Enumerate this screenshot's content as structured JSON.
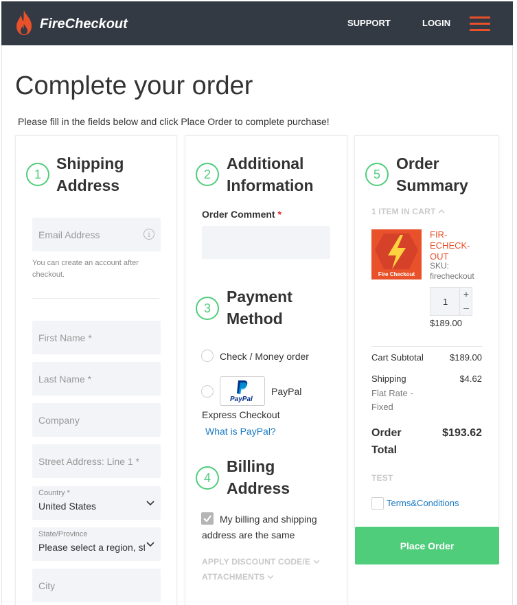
{
  "header": {
    "logo_text": "FireCheckout",
    "nav": {
      "support": "SUPPORT",
      "login": "LOGIN"
    }
  },
  "page": {
    "title": "Complete your order",
    "subtitle": "Please fill in the fields below and click Place Order to complete purchase!"
  },
  "shipping": {
    "step": "1",
    "title_line1": "Shipping",
    "title_line2": "Address",
    "email_placeholder": "Email Address",
    "email_hint": "You can create an account after checkout.",
    "first_name": "First Name *",
    "last_name": "Last Name *",
    "company": "Company",
    "street": "Street Address: Line 1 *",
    "country_label": "Country *",
    "country_value": "United States",
    "state_label": "State/Province",
    "state_value": "Please select a region, st",
    "city": "City"
  },
  "additional": {
    "step": "2",
    "title_line1": "Additional",
    "title_line2": "Information",
    "comment_label": "Order Comment",
    "required_mark": "*"
  },
  "payment": {
    "step": "3",
    "title_line1": "Payment",
    "title_line2": "Method",
    "option_check": "Check / Money order",
    "option_paypal_line1": "PayPal",
    "option_paypal_line2": "Express Checkout",
    "paypal_logo_text": "PayPal",
    "paypal_link": "What is PayPal?"
  },
  "billing": {
    "step": "4",
    "title_line1": "Billing",
    "title_line2": "Address",
    "same_line1": "My billing and shipping",
    "same_line2": "address are the same",
    "discount": "APPLY DISCOUNT CODE/E",
    "attachments": "ATTACHMENTS"
  },
  "summary": {
    "step": "5",
    "title_line1": "Order",
    "title_line2": "Summary",
    "items_in_cart": "1 ITEM IN CART",
    "product": {
      "name": "FIR-ECHECK-OUT",
      "thumb_label": "Fire Checkout",
      "sku_label": "SKU:",
      "sku": "firecheckout",
      "qty": "1",
      "price": "$189.00"
    },
    "subtotal_label": "Cart Subtotal",
    "subtotal_value": "$189.00",
    "shipping_label": "Shipping",
    "shipping_method": "Flat Rate - Fixed",
    "shipping_value": "$4.62",
    "total_label": "Order Total",
    "total_value": "$193.62",
    "test_label": "TEST",
    "terms_link": "Terms&Conditions",
    "place_order": "Place Order"
  },
  "icons": {
    "step_color": "#4fcd7b",
    "accent": "#e8512a",
    "place_order_bg": "#4fcd7b",
    "header_bg": "#343a44"
  }
}
